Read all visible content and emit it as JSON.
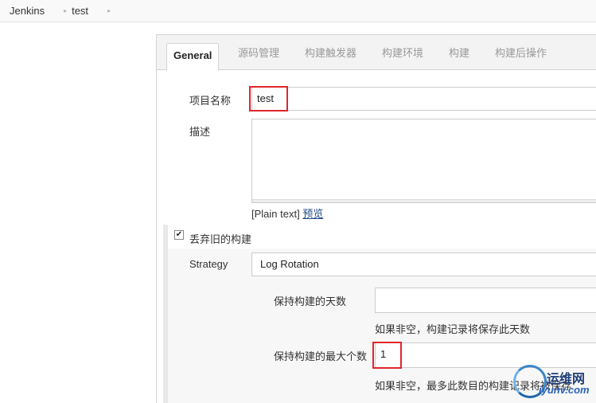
{
  "breadcrumb": {
    "items": [
      "Jenkins",
      "test"
    ],
    "separator": "▸"
  },
  "tabs": [
    {
      "label": "General",
      "active": true
    },
    {
      "label": "源码管理",
      "active": false
    },
    {
      "label": "构建触发器",
      "active": false
    },
    {
      "label": "构建环境",
      "active": false
    },
    {
      "label": "构建",
      "active": false
    },
    {
      "label": "构建后操作",
      "active": false
    }
  ],
  "form": {
    "project_name_label": "项目名称",
    "project_name_value": "test",
    "description_label": "描述",
    "plain_text_prefix": "[Plain text]",
    "preview_link": "预览",
    "discard_label": "丢弃旧的构建",
    "discard_checked": true,
    "strategy_label": "Strategy",
    "strategy_value": "Log Rotation",
    "days_label": "保持构建的天数",
    "days_value": "",
    "days_hint": "如果非空，构建记录将保存此天数",
    "max_label": "保持构建的最大个数",
    "max_value": "1",
    "max_hint": "如果非空，最多此数目的构建记录将被保存"
  },
  "watermark": {
    "line1": "运维网",
    "line2": "iyunv.com"
  },
  "colors": {
    "highlight": "#e0262b",
    "link": "#204a87"
  }
}
